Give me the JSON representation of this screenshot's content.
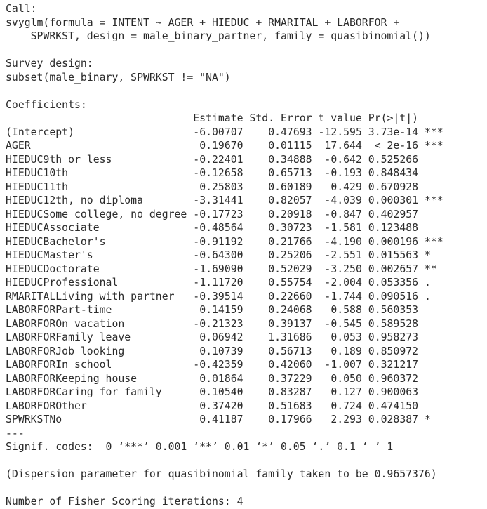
{
  "call": {
    "header": "Call:",
    "lines": [
      "svyglm(formula = INTENT ~ AGER + HIEDUC + RMARITAL + LABORFOR +",
      "    SPWRKST, design = male_binary_partner, family = quasibinomial())"
    ]
  },
  "survey_design": {
    "header": "Survey design:",
    "line": "subset(male_binary, SPWRKST != \"NA\")"
  },
  "coefficients": {
    "header": "Coefficients:",
    "columns": [
      "Estimate",
      "Std. Error",
      "t value",
      "Pr(>|t|)"
    ],
    "rows": [
      {
        "term": "(Intercept)",
        "estimate": "-6.00707",
        "std_error": "0.47693",
        "t_value": "-12.595",
        "p_value": "3.73e-14",
        "signif": "***"
      },
      {
        "term": "AGER",
        "estimate": "0.19670",
        "std_error": "0.01115",
        "t_value": "17.644",
        "p_value": "< 2e-16",
        "signif": "***"
      },
      {
        "term": "HIEDUC9th or less",
        "estimate": "-0.22401",
        "std_error": "0.34888",
        "t_value": "-0.642",
        "p_value": "0.525266",
        "signif": ""
      },
      {
        "term": "HIEDUC10th",
        "estimate": "-0.12658",
        "std_error": "0.65713",
        "t_value": "-0.193",
        "p_value": "0.848434",
        "signif": ""
      },
      {
        "term": "HIEDUC11th",
        "estimate": "0.25803",
        "std_error": "0.60189",
        "t_value": "0.429",
        "p_value": "0.670928",
        "signif": ""
      },
      {
        "term": "HIEDUC12th, no diploma",
        "estimate": "-3.31441",
        "std_error": "0.82057",
        "t_value": "-4.039",
        "p_value": "0.000301",
        "signif": "***"
      },
      {
        "term": "HIEDUCSome college, no degree",
        "estimate": "-0.17723",
        "std_error": "0.20918",
        "t_value": "-0.847",
        "p_value": "0.402957",
        "signif": ""
      },
      {
        "term": "HIEDUCAssociate",
        "estimate": "-0.48564",
        "std_error": "0.30723",
        "t_value": "-1.581",
        "p_value": "0.123488",
        "signif": ""
      },
      {
        "term": "HIEDUCBachelor's",
        "estimate": "-0.91192",
        "std_error": "0.21766",
        "t_value": "-4.190",
        "p_value": "0.000196",
        "signif": "***"
      },
      {
        "term": "HIEDUCMaster's",
        "estimate": "-0.64300",
        "std_error": "0.25206",
        "t_value": "-2.551",
        "p_value": "0.015563",
        "signif": "*"
      },
      {
        "term": "HIEDUCDoctorate",
        "estimate": "-1.69090",
        "std_error": "0.52029",
        "t_value": "-3.250",
        "p_value": "0.002657",
        "signif": "**"
      },
      {
        "term": "HIEDUCProfessional",
        "estimate": "-1.11720",
        "std_error": "0.55754",
        "t_value": "-2.004",
        "p_value": "0.053356",
        "signif": "."
      },
      {
        "term": "RMARITALLiving with partner",
        "estimate": "-0.39514",
        "std_error": "0.22660",
        "t_value": "-1.744",
        "p_value": "0.090516",
        "signif": "."
      },
      {
        "term": "LABORFORPart-time",
        "estimate": "0.14159",
        "std_error": "0.24068",
        "t_value": "0.588",
        "p_value": "0.560353",
        "signif": ""
      },
      {
        "term": "LABORFOROn vacation",
        "estimate": "-0.21323",
        "std_error": "0.39137",
        "t_value": "-0.545",
        "p_value": "0.589528",
        "signif": ""
      },
      {
        "term": "LABORFORFamily leave",
        "estimate": "0.06942",
        "std_error": "1.31686",
        "t_value": "0.053",
        "p_value": "0.958273",
        "signif": ""
      },
      {
        "term": "LABORFORJob looking",
        "estimate": "0.10739",
        "std_error": "0.56713",
        "t_value": "0.189",
        "p_value": "0.850972",
        "signif": ""
      },
      {
        "term": "LABORFORIn school",
        "estimate": "-0.42359",
        "std_error": "0.42060",
        "t_value": "-1.007",
        "p_value": "0.321217",
        "signif": ""
      },
      {
        "term": "LABORFORKeeping house",
        "estimate": "0.01864",
        "std_error": "0.37229",
        "t_value": "0.050",
        "p_value": "0.960372",
        "signif": ""
      },
      {
        "term": "LABORFORCaring for family",
        "estimate": "0.10540",
        "std_error": "0.83287",
        "t_value": "0.127",
        "p_value": "0.900063",
        "signif": ""
      },
      {
        "term": "LABORFOROther",
        "estimate": "0.37420",
        "std_error": "0.51683",
        "t_value": "0.724",
        "p_value": "0.474150",
        "signif": ""
      },
      {
        "term": "SPWRKSTNo",
        "estimate": "0.41187",
        "std_error": "0.17966",
        "t_value": "2.293",
        "p_value": "0.028387",
        "signif": "*"
      }
    ]
  },
  "separator": "---",
  "signif_codes": "Signif. codes:  0 ‘***’ 0.001 ‘**’ 0.01 ‘*’ 0.05 ‘.’ 0.1 ‘ ’ 1",
  "dispersion": "(Dispersion parameter for quasibinomial family taken to be 0.9657376)",
  "fisher": "Number of Fisher Scoring iterations: 4"
}
